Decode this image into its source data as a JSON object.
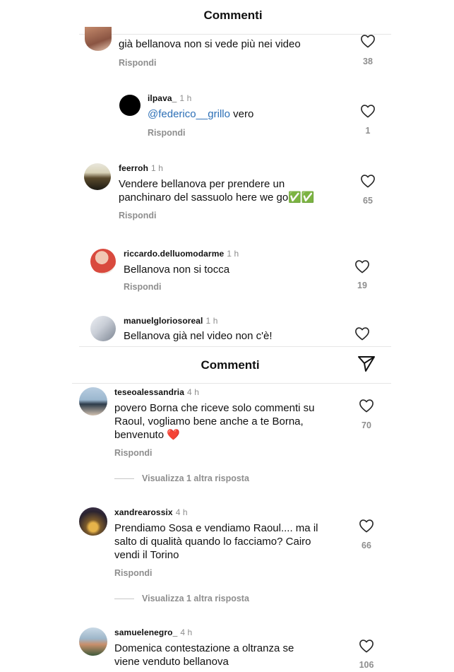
{
  "panel1": {
    "title": "Commenti",
    "comments": [
      {
        "username": "",
        "time": "",
        "text": "già bellanova non si vede più nei video",
        "reply_label": "Rispondi",
        "likes": "38"
      },
      {
        "username": "ilpava_",
        "time": "1 h",
        "mention": "@federico__grillo",
        "text": " vero",
        "reply_label": "Rispondi",
        "likes": "1"
      },
      {
        "username": "feerroh",
        "time": "1 h",
        "text_line1": "Vendere bellanova per prendere un",
        "text_line2": "panchinaro del sassuolo here we go",
        "emoji": "✅✅",
        "reply_label": "Rispondi",
        "likes": "65"
      },
      {
        "username": "riccardo.delluomodarme",
        "time": "1 h",
        "text": "Bellanova non si tocca",
        "reply_label": "Rispondi",
        "likes": "19"
      },
      {
        "username": "manuelgloriosoreal",
        "time": "1 h",
        "text": "Bellanova già nel video non c'è!"
      }
    ]
  },
  "panel2": {
    "title": "Commenti",
    "comments": [
      {
        "username": "teseoalessandria",
        "time": "4 h",
        "line1": "povero Borna che riceve solo commenti su",
        "line2": "Raoul, vogliamo bene anche a te Borna,",
        "line3": "benvenuto",
        "emoji": "❤️",
        "reply_label": "Rispondi",
        "likes": "70",
        "view_more": "Visualizza 1 altra risposta"
      },
      {
        "username": "xandrearossix",
        "time": "4 h",
        "line1": "Prendiamo Sosa e vendiamo Raoul.... ma il",
        "line2": "salto di qualità quando lo facciamo? Cairo",
        "line3": "vendi il Torino",
        "reply_label": "Rispondi",
        "likes": "66",
        "view_more": "Visualizza 1 altra risposta"
      },
      {
        "username": "samuelenegro_",
        "time": "4 h",
        "line1": "Domenica contestazione a oltranza se",
        "line2": "viene venduto bellanova",
        "likes": "106"
      }
    ]
  },
  "icons": {
    "heart": "heart-icon",
    "send": "paper-plane-icon"
  },
  "colors": {
    "mention": "#2c6fb6",
    "secondary_text": "#8e8e8e",
    "check_emoji": "#4caf50"
  }
}
